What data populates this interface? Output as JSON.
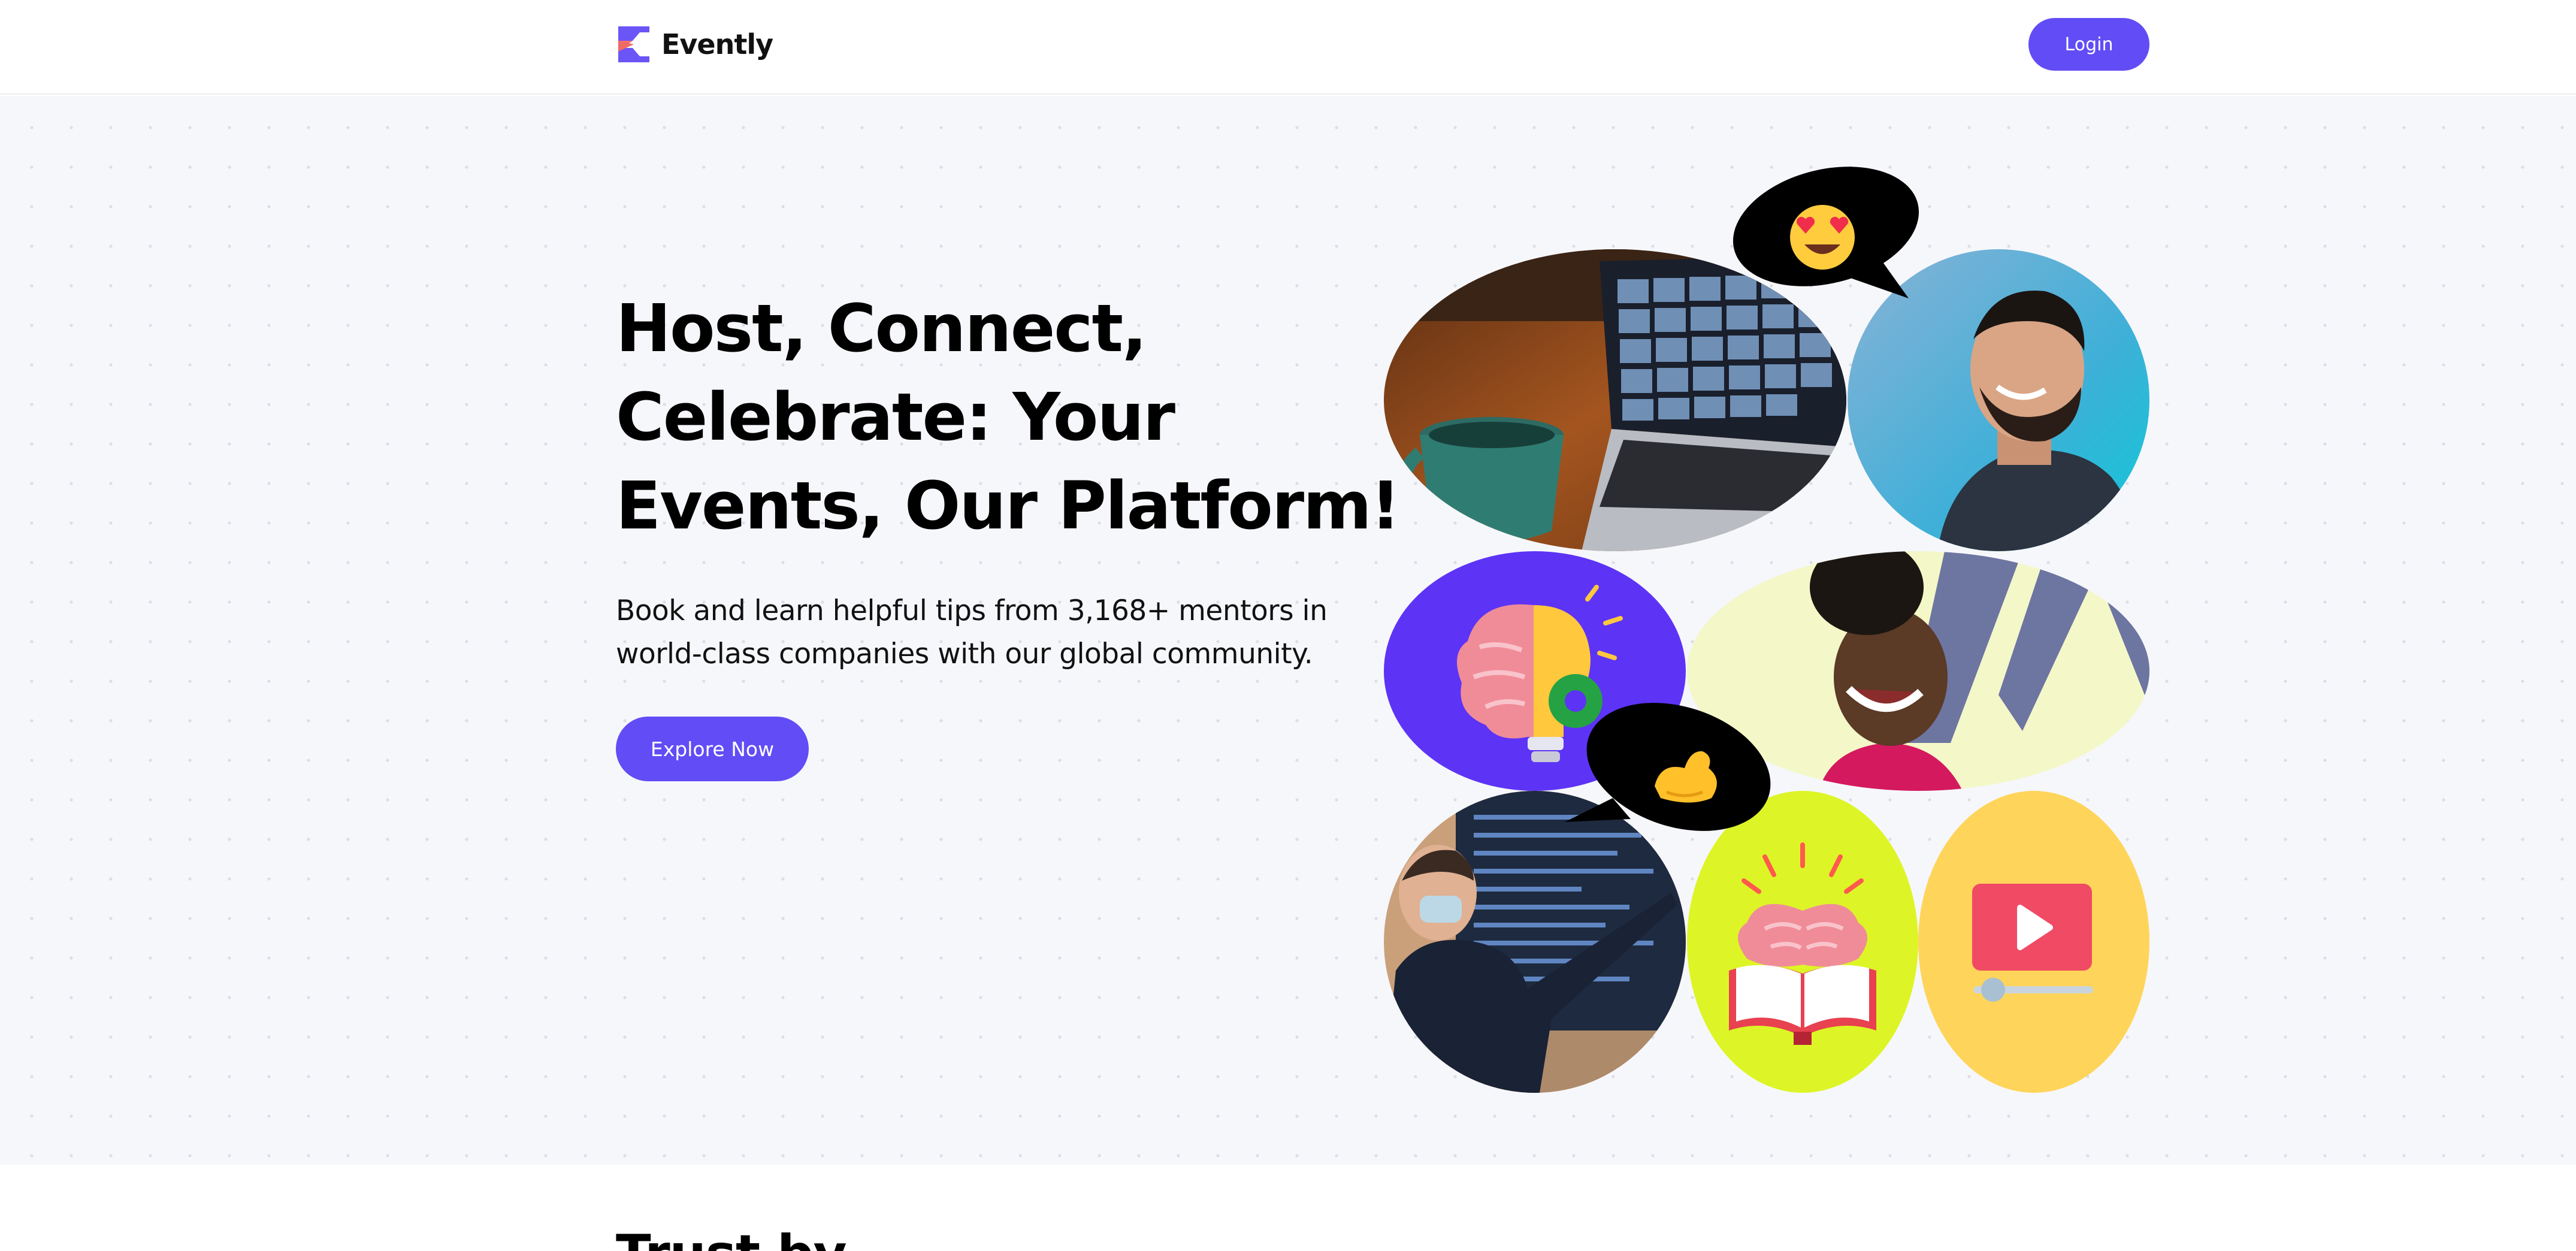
{
  "header": {
    "brand": "Evently",
    "login_label": "Login"
  },
  "hero": {
    "title_lines": [
      "Host, Connect,",
      "Celebrate: Your",
      "Events, Our Platform!"
    ],
    "subtitle_lines": [
      "Book and learn helpful tips from 3,168+ mentors in",
      "world-class companies with our global community."
    ],
    "cta_label": "Explore Now"
  },
  "collage": {
    "tiles": [
      {
        "name": "photo-laptop-video-call",
        "icon": "laptop-video-call-photo"
      },
      {
        "name": "photo-smiling-man",
        "icon": "smiling-man-photo"
      },
      {
        "name": "illustration-brain-lightbulb",
        "icon": "brain-lightbulb-icon"
      },
      {
        "name": "photo-laughing-woman",
        "icon": "laughing-woman-photo"
      },
      {
        "name": "photo-presenter-screen",
        "icon": "presenter-photo"
      },
      {
        "name": "illustration-brain-book",
        "icon": "brain-book-icon"
      },
      {
        "name": "illustration-video-player",
        "icon": "video-player-icon"
      }
    ],
    "bubbles": [
      {
        "name": "heart-eyes-emoji-bubble",
        "icon": "heart-eyes-emoji"
      },
      {
        "name": "flexed-arm-emoji-bubble",
        "icon": "flexed-biceps-emoji"
      }
    ]
  },
  "trust": {
    "title": "Trust by"
  },
  "colors": {
    "accent": "#624cf5",
    "hero_bg": "#f6f7fb",
    "lime": "#ddf526",
    "yellow": "#ffd45a",
    "bubble": "#000000",
    "text": "#000000"
  }
}
